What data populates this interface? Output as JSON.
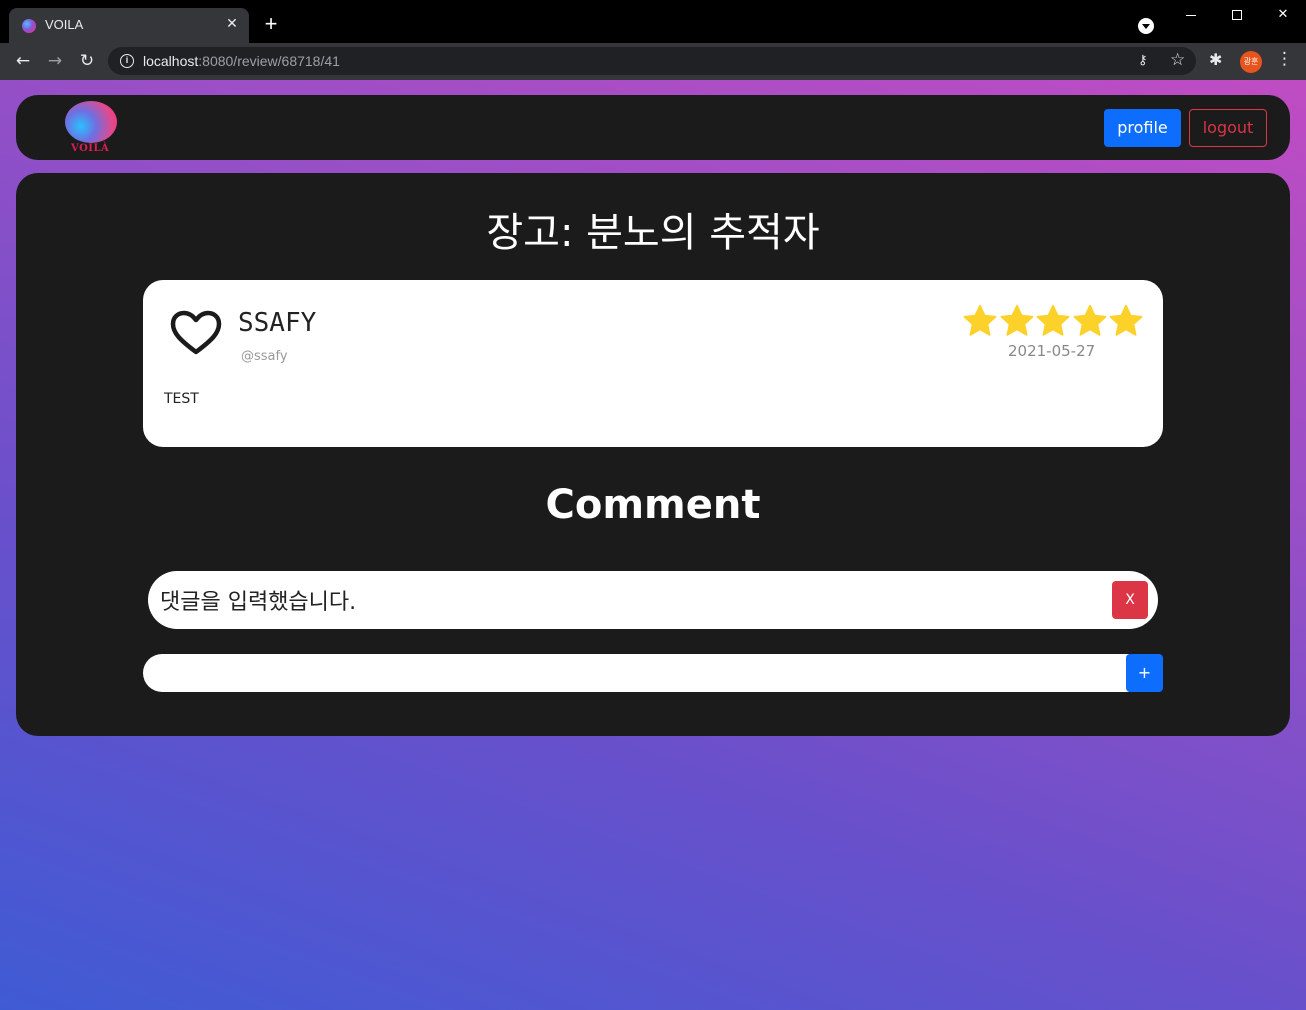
{
  "browser": {
    "tab_title": "VOILA",
    "tab_close": "✕",
    "new_tab": "+",
    "url_host": "localhost",
    "url_path": ":8080/review/68718/41",
    "avatar_text": "광훈",
    "icons": {
      "back": "arrow-left-icon",
      "forward": "arrow-right-icon",
      "reload": "reload-icon",
      "info": "info-icon",
      "key": "key-icon",
      "star": "bookmark-star-icon",
      "extensions": "puzzle-icon",
      "menu": "kebab-menu-icon"
    }
  },
  "navbar": {
    "logo_text": "VOILÀ",
    "profile_label": "profile",
    "logout_label": "logout"
  },
  "review": {
    "movie_title": "장고: 분노의 추적자",
    "username": "SSAFY",
    "handle": "@ssafy",
    "content": "TEST",
    "rating": 5,
    "rating_max": 5,
    "date": "2021-05-27",
    "liked": false
  },
  "comments": {
    "heading": "Comment",
    "items": [
      {
        "text": "댓글을 입력했습니다.",
        "delete_label": "X"
      }
    ],
    "input_value": "",
    "add_label": "+"
  },
  "colors": {
    "primary": "#0d6efd",
    "danger": "#dc3545",
    "panel": "#1b1b1b",
    "star": "#fcd12a",
    "gradient_start": "#3f5bd4",
    "gradient_end": "#c04cc3"
  }
}
